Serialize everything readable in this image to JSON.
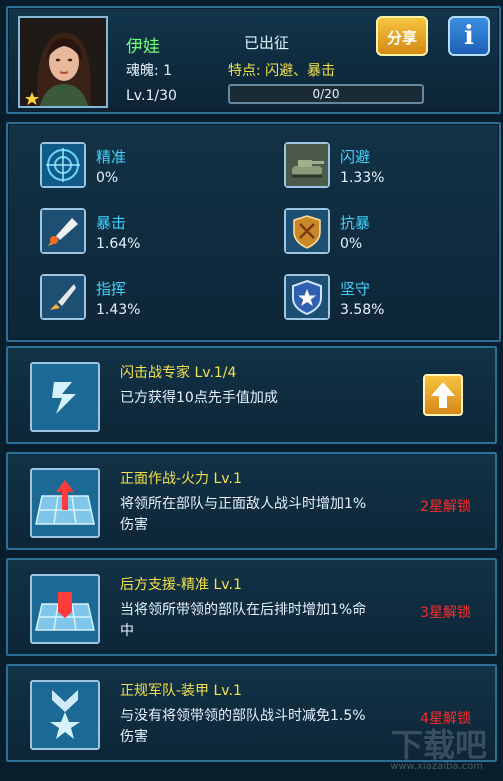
{
  "header": {
    "name": "伊娃",
    "soul": "魂魄: 1",
    "level": "Lv.1/30",
    "status": "已出征",
    "traits_label": "特点:",
    "traits": "闪避、暴击",
    "progress_text": "0/20",
    "progress_fraction": 0,
    "share_label": "分享",
    "info_label": "i"
  },
  "stats": [
    {
      "label": "精准",
      "value": "0%",
      "icon": "radar-icon"
    },
    {
      "label": "闪避",
      "value": "1.33%",
      "icon": "tank-icon"
    },
    {
      "label": "暴击",
      "value": "1.64%",
      "icon": "missile-icon"
    },
    {
      "label": "抗暴",
      "value": "0%",
      "icon": "shield-icon"
    },
    {
      "label": "指挥",
      "value": "1.43%",
      "icon": "rocket-icon"
    },
    {
      "label": "坚守",
      "value": "3.58%",
      "icon": "star-shield-icon"
    }
  ],
  "skills": [
    {
      "title": "闪击战专家 Lv.1/4",
      "desc": "已方获得10点先手值加成",
      "lock": "",
      "icon": "lightning-icon"
    },
    {
      "title": "正面作战-火力 Lv.1",
      "desc": "将领所在部队与正面敌人战斗时增加1%伤害",
      "lock": "2星解锁",
      "icon": "grid-front-icon"
    },
    {
      "title": "后方支援-精准 Lv.1",
      "desc": "当将领所带领的部队在后排时增加1%命中",
      "lock": "3星解锁",
      "icon": "grid-rear-icon"
    },
    {
      "title": "正规军队-装甲 Lv.1",
      "desc": "与没有将领带领的部队战斗时减免1.5%伤害",
      "lock": "4星解锁",
      "icon": "medal-icon"
    }
  ],
  "watermark": "下载吧",
  "watermark_sub": "www.xiazaiba.com",
  "colors": {
    "name": "#6dff7a",
    "stat_label": "#3fd2ff",
    "skill_title": "#f4e24a",
    "lock": "#ff2a2a"
  }
}
